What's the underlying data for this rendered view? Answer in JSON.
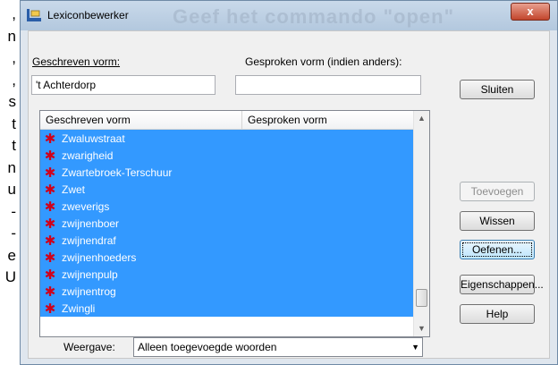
{
  "background": {
    "left_chars": [
      ",",
      "n",
      ",",
      ",",
      "s",
      "t",
      "t",
      "n",
      "u",
      "-",
      "-",
      "e",
      "U"
    ],
    "title_ghost": "Geef het commando \"open\""
  },
  "window": {
    "title": "Lexiconbewerker",
    "close_label": "x"
  },
  "form": {
    "written_label": "Geschreven vorm:",
    "written_value": "'t Achterdorp",
    "spoken_label": "Gesproken vorm (indien anders):",
    "spoken_value": ""
  },
  "list": {
    "columns": [
      "Geschreven vorm",
      "Gesproken vorm"
    ],
    "rows": [
      "Zwaluwstraat",
      "zwarigheid",
      "Zwartebroek-Terschuur",
      "Zwet",
      "zweverigs",
      "zwijnenboer",
      "zwijnendraf",
      "zwijnenhoeders",
      "zwijnenpulp",
      "zwijnentrog",
      "Zwingli"
    ],
    "scroll_fraction": 0.92
  },
  "buttons": {
    "close": "Sluiten",
    "add": "Toevoegen",
    "delete": "Wissen",
    "practice": "Oefenen...",
    "properties": "Eigenschappen...",
    "help": "Help"
  },
  "view": {
    "label": "Weergave:",
    "selected": "Alleen toegevoegde woorden"
  }
}
